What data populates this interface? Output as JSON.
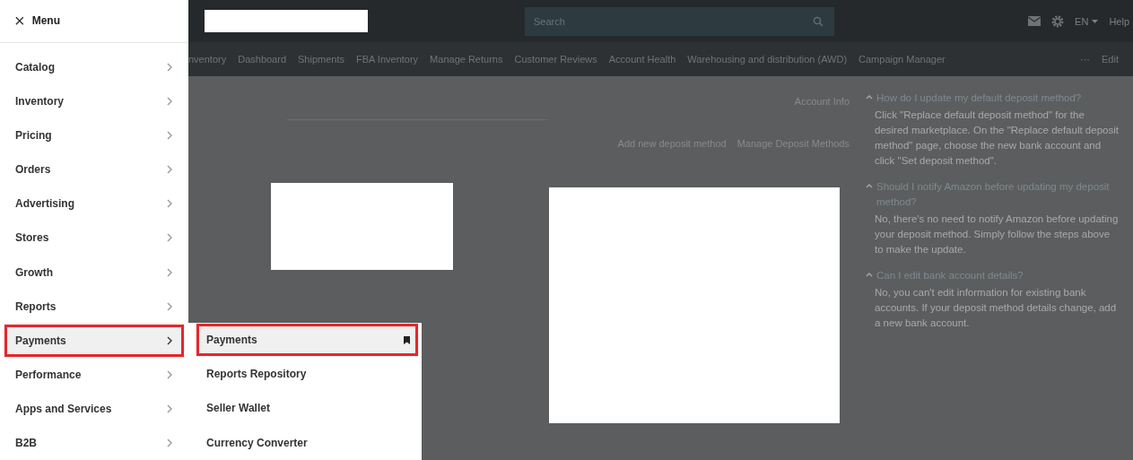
{
  "menu": {
    "close_icon": "×",
    "title": "Menu",
    "items": [
      {
        "label": "Catalog",
        "selected": false
      },
      {
        "label": "Inventory",
        "selected": false
      },
      {
        "label": "Pricing",
        "selected": false
      },
      {
        "label": "Orders",
        "selected": false
      },
      {
        "label": "Advertising",
        "selected": false
      },
      {
        "label": "Stores",
        "selected": false
      },
      {
        "label": "Growth",
        "selected": false
      },
      {
        "label": "Reports",
        "selected": false
      },
      {
        "label": "Payments",
        "selected": true
      },
      {
        "label": "Performance",
        "selected": false
      },
      {
        "label": "Apps and Services",
        "selected": false
      },
      {
        "label": "B2B",
        "selected": false
      }
    ]
  },
  "submenu": {
    "items": [
      {
        "label": "Payments",
        "selected": true,
        "pinned": true
      },
      {
        "label": "Reports Repository",
        "selected": false,
        "pinned": false
      },
      {
        "label": "Seller Wallet",
        "selected": false,
        "pinned": false
      },
      {
        "label": "Currency Converter",
        "selected": false,
        "pinned": false
      }
    ]
  },
  "top_bar": {
    "search": {
      "placeholder": "Search"
    },
    "language": "EN",
    "help": "Help"
  },
  "nav_bar": {
    "items": [
      "nventory",
      "Dashboard",
      "Shipments",
      "FBA Inventory",
      "Manage Returns",
      "Customer Reviews",
      "Account Health",
      "Warehousing and distribution (AWD)",
      "Campaign Manager"
    ],
    "more": "···",
    "edit": "Edit"
  },
  "page": {
    "account_info": "Account Info",
    "add_deposit": "Add new deposit method",
    "manage_deposit": "Manage Deposit Methods"
  },
  "faq": [
    {
      "question": "How do I update my default deposit method?",
      "expanded": true,
      "answer": "Click \"Replace default deposit method\" for the desired marketplace. On the \"Replace default deposit method\" page, choose the new bank account and click \"Set deposit method\"."
    },
    {
      "question": "Should I notify Amazon before updating my deposit method?",
      "expanded": true,
      "answer": "No, there's no need to notify Amazon before updating your deposit method. Simply follow the steps above to make the update."
    },
    {
      "question": "Can I edit bank account details?",
      "expanded": true,
      "answer": "No, you can't edit information for existing bank accounts. If your deposit method details change, add a new bank account."
    }
  ]
}
